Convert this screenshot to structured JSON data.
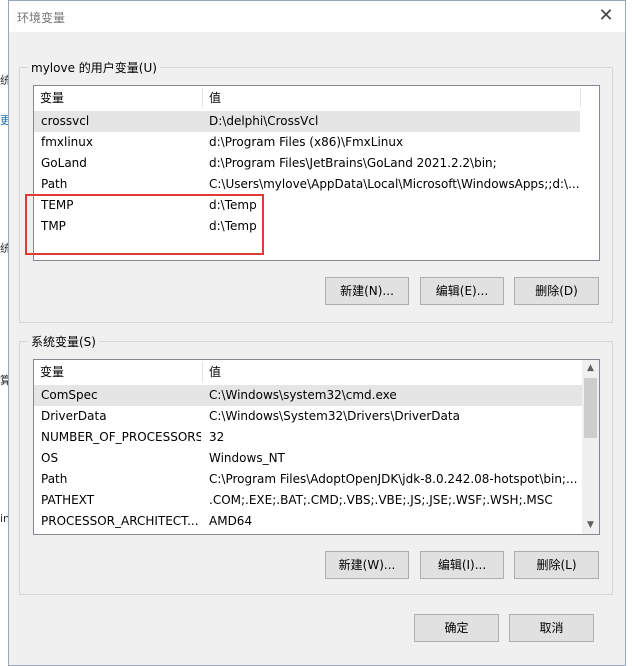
{
  "dialog_title": "环境变量",
  "close_glyph": "✕",
  "background_fragments": [
    "统",
    "更",
    "统",
    "算",
    "in"
  ],
  "user_vars": {
    "group_label": "mylove 的用户变量(U)",
    "columns": [
      "变量",
      "值"
    ],
    "rows": [
      {
        "name": "crossvcl",
        "value": "D:\\delphi\\CrossVcl"
      },
      {
        "name": "fmxlinux",
        "value": "d:\\Program Files (x86)\\FmxLinux"
      },
      {
        "name": "GoLand",
        "value": "d:\\Program Files\\JetBrains\\GoLand 2021.2.2\\bin;"
      },
      {
        "name": "Path",
        "value": "C:\\Users\\mylove\\AppData\\Local\\Microsoft\\WindowsApps;;d:\\..."
      },
      {
        "name": "TEMP",
        "value": "d:\\Temp"
      },
      {
        "name": "TMP",
        "value": "d:\\Temp"
      }
    ],
    "buttons": [
      "新建(N)...",
      "编辑(E)...",
      "删除(D)"
    ]
  },
  "system_vars": {
    "group_label": "系统变量(S)",
    "columns": [
      "变量",
      "值"
    ],
    "rows": [
      {
        "name": "ComSpec",
        "value": "C:\\Windows\\system32\\cmd.exe"
      },
      {
        "name": "DriverData",
        "value": "C:\\Windows\\System32\\Drivers\\DriverData"
      },
      {
        "name": "NUMBER_OF_PROCESSORS",
        "value": "32"
      },
      {
        "name": "OS",
        "value": "Windows_NT"
      },
      {
        "name": "Path",
        "value": "C:\\Program Files\\AdoptOpenJDK\\jdk-8.0.242.08-hotspot\\bin;..."
      },
      {
        "name": "PATHEXT",
        "value": ".COM;.EXE;.BAT;.CMD;.VBS;.VBE;.JS;.JSE;.WSF;.WSH;.MSC"
      },
      {
        "name": "PROCESSOR_ARCHITECT...",
        "value": "AMD64"
      }
    ],
    "buttons": [
      "新建(W)...",
      "编辑(I)...",
      "删除(L)"
    ]
  },
  "footer_buttons": [
    "确定",
    "取消"
  ]
}
